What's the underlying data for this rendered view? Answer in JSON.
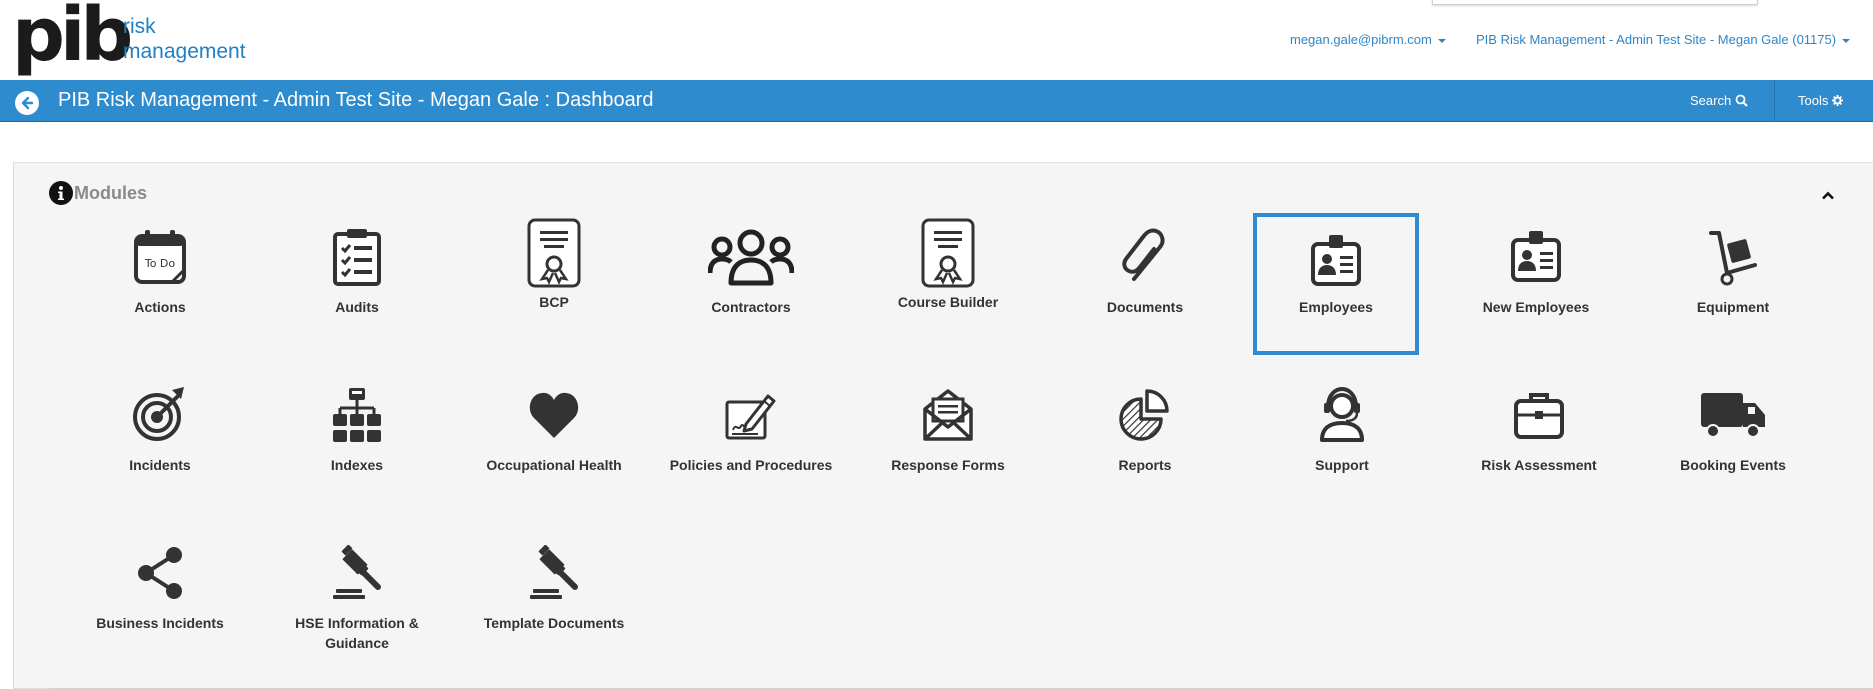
{
  "brand": {
    "logo_main": "pib",
    "logo_line1": "risk",
    "logo_line2": "management"
  },
  "header": {
    "user_email": "megan.gale@pibrm.com",
    "site_selector": "PIB Risk Management - Admin Test Site - Megan Gale (01175)"
  },
  "navbar": {
    "title": "PIB Risk Management - Admin Test Site - Megan Gale : Dashboard",
    "search_label": "Search",
    "tools_label": "Tools"
  },
  "modules_panel": {
    "title": "Modules",
    "items": [
      {
        "label": "Actions",
        "icon": "todo-calendar-icon"
      },
      {
        "label": "Audits",
        "icon": "checklist-clipboard-icon"
      },
      {
        "label": "BCP",
        "icon": "certificate-icon"
      },
      {
        "label": "Contractors",
        "icon": "users-group-icon"
      },
      {
        "label": "Course Builder",
        "icon": "certificate-icon"
      },
      {
        "label": "Documents",
        "icon": "paperclip-icon"
      },
      {
        "label": "Employees",
        "icon": "id-badge-icon",
        "selected": true
      },
      {
        "label": "New Employees",
        "icon": "id-badge-icon"
      },
      {
        "label": "Equipment",
        "icon": "hand-truck-icon"
      },
      {
        "label": "Incidents",
        "icon": "target-arrow-icon"
      },
      {
        "label": "Indexes",
        "icon": "sitemap-icon"
      },
      {
        "label": "Occupational Health",
        "icon": "heart-icon"
      },
      {
        "label": "Policies and Procedures",
        "icon": "signature-document-icon"
      },
      {
        "label": "Response Forms",
        "icon": "open-envelope-icon"
      },
      {
        "label": "Reports",
        "icon": "pie-chart-icon"
      },
      {
        "label": "Support",
        "icon": "headset-agent-icon"
      },
      {
        "label": "Risk Assessment",
        "icon": "briefcase-icon"
      },
      {
        "label": "Booking Events",
        "icon": "truck-icon"
      },
      {
        "label": "Business Incidents",
        "icon": "share-nodes-icon"
      },
      {
        "label": "HSE Information & Guidance",
        "icon": "gavel-icon"
      },
      {
        "label": "Template Documents",
        "icon": "gavel-icon"
      }
    ]
  },
  "colors": {
    "accent": "#2e8bcd",
    "brand_blue": "#1f80c4",
    "icon_dark": "#333333"
  }
}
